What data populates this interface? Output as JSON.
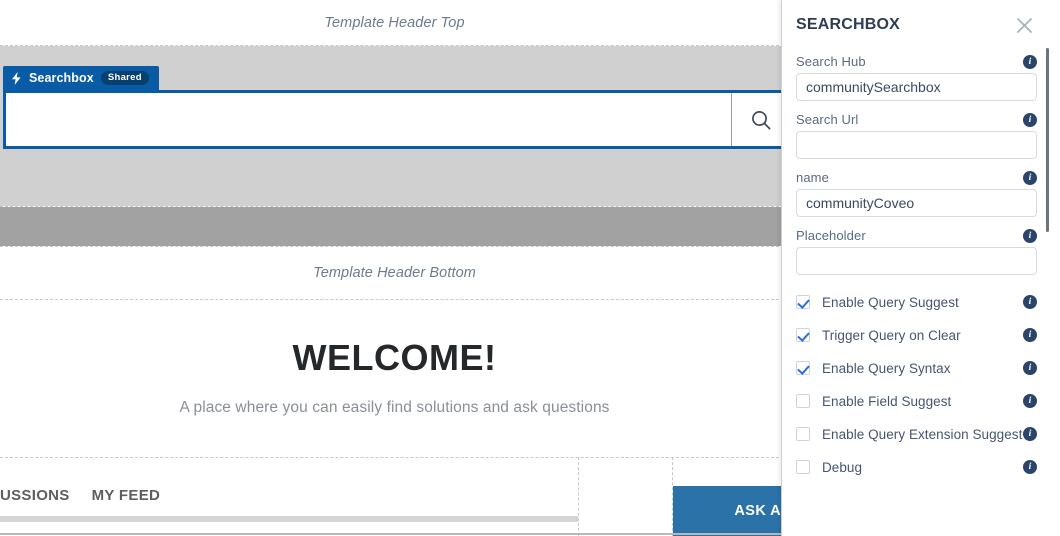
{
  "canvas": {
    "header_top_label": "Template Header Top",
    "header_bottom_label": "Template Header Bottom",
    "component": {
      "tab_label": "Searchbox",
      "badge_label": "Shared",
      "bolt_icon": "lightning-bolt-icon",
      "search_icon": "search-icon",
      "search_input_value": "",
      "accent_color": "#0a5ba5"
    },
    "welcome": {
      "title": "WELCOME!",
      "subtitle": "A place where you can easily find solutions and ask questions"
    },
    "bottom_nav": {
      "items": [
        {
          "label": "USSIONS"
        },
        {
          "label": "MY FEED"
        }
      ],
      "ask_button_label": "ASK A",
      "ask_button_color": "#2a72a8"
    }
  },
  "panel": {
    "title": "SEARCHBOX",
    "close_icon": "close-icon",
    "info_icon_glyph": "i",
    "fields": [
      {
        "label": "Search Hub",
        "value": "communitySearchbox",
        "placeholder": ""
      },
      {
        "label": "Search Url",
        "value": "",
        "placeholder": ""
      },
      {
        "label": "name",
        "value": "communityCoveo",
        "placeholder": ""
      },
      {
        "label": "Placeholder",
        "value": "",
        "placeholder": ""
      }
    ],
    "checkboxes": [
      {
        "label": "Enable Query Suggest",
        "checked": true
      },
      {
        "label": "Trigger Query on Clear",
        "checked": true
      },
      {
        "label": "Enable Query Syntax",
        "checked": true
      },
      {
        "label": "Enable Field Suggest",
        "checked": false
      },
      {
        "label": "Enable Query Extension Suggest",
        "checked": false
      },
      {
        "label": "Debug",
        "checked": false
      }
    ],
    "accent_color": "#2b4469",
    "check_color": "#2a6ddb"
  }
}
